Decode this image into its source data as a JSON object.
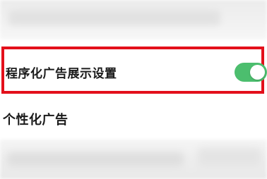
{
  "setting": {
    "label": "程序化广告展示设置",
    "toggle_on": true,
    "toggle_color": "#4cbe6e",
    "highlight_color": "#e3101b"
  },
  "section": {
    "title": "个性化广告"
  }
}
